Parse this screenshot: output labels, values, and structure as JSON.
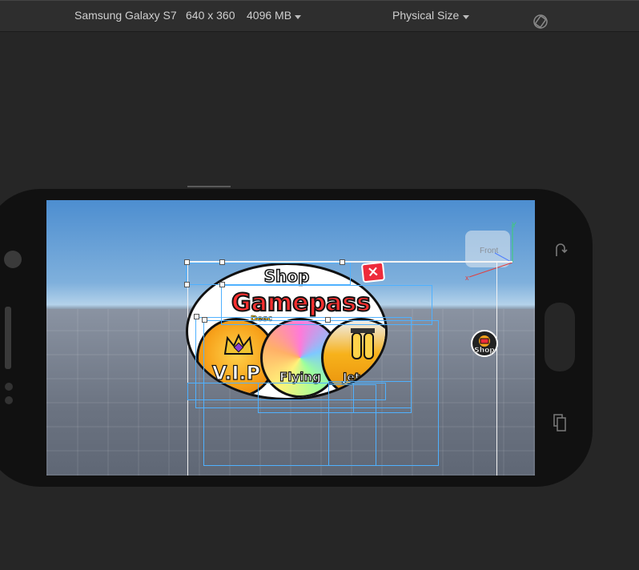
{
  "toolbar": {
    "device_name": "Samsung Galaxy S7",
    "resolution": "640 x 360",
    "memory": "4096 MB",
    "size_mode": "Physical Size"
  },
  "game_ui": {
    "shop_header": "Shop",
    "gamepass_title": "Gamepass",
    "gamepass_subtitle": "Desc",
    "items": [
      {
        "label": "V.I.P"
      },
      {
        "label": "Flying"
      },
      {
        "label": "Jet pa"
      }
    ],
    "close_label": "×",
    "shop_button_label": "Shop"
  },
  "viewport": {
    "view_cube_label": "Front",
    "axis_x": "x",
    "axis_y": "Y"
  },
  "colors": {
    "accent_red": "#ee2b3b",
    "selection_blue": "#4fb1ff",
    "vip_orange": "#f7a21b"
  }
}
